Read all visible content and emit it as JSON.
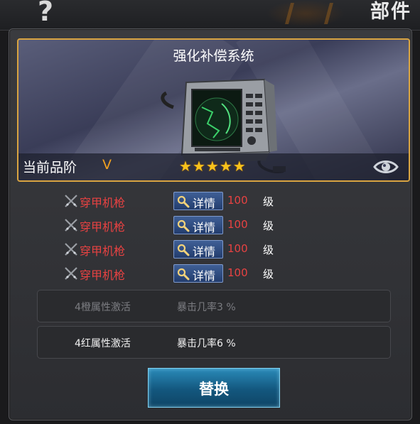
{
  "header": {
    "help_glyph": "?",
    "section_title": "部件"
  },
  "item": {
    "name": "强化补偿系统",
    "grade_label": "当前品阶",
    "grade_value": "V",
    "stars": 5,
    "star_glyph": "★",
    "frame_color": "#d9a441"
  },
  "set_pieces": [
    {
      "name": "穿甲机枪",
      "detail_label": "详情",
      "level": "100",
      "level_unit": "级"
    },
    {
      "name": "穿甲机枪",
      "detail_label": "详情",
      "level": "100",
      "level_unit": "级"
    },
    {
      "name": "穿甲机枪",
      "detail_label": "详情",
      "level": "100",
      "level_unit": "级"
    },
    {
      "name": "穿甲机枪",
      "detail_label": "详情",
      "level": "100",
      "level_unit": "级"
    }
  ],
  "set_bonuses": [
    {
      "condition": "4橙属性激活",
      "effect": "暴击几率3 %",
      "active": false
    },
    {
      "condition": "4红属性激活",
      "effect": "暴击几率6 %",
      "active": true
    }
  ],
  "actions": {
    "replace_label": "替换"
  },
  "colors": {
    "piece_name": "#e84242",
    "grade": "#f0a020",
    "star": "#f6c21c",
    "button_blue": "#233d6e"
  }
}
